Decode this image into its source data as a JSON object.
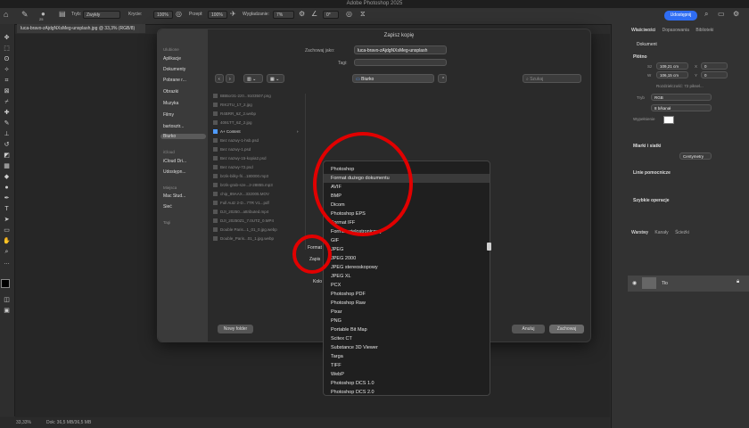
{
  "app": {
    "title": "Adobe Photoshop 2025",
    "share_label": "Udostępnij"
  },
  "options_bar": {
    "mode_label": "Tryb:",
    "mode_value": "Zwykły",
    "opacity_label": "Krycie:",
    "opacity_value": "100%",
    "flow_label": "Przepł:",
    "flow_value": "100%",
    "smoothing_label": "Wygładzanie:",
    "smoothing_value": "7%",
    "angle_value": "0°",
    "brush_size": "25"
  },
  "document_tab": {
    "label": "luca-bravo-zAjdgNXsMeg-unsplash.jpg @ 33,3% (RGB/8)"
  },
  "status": {
    "zoom": "33,33%",
    "doc": "Dok: 36,5 MB/36,5 MB"
  },
  "dialog": {
    "title": "Zapisz kopię",
    "save_as_label": "Zachowaj jako:",
    "save_as_value": "luca-bravo-zAjdgNXsMeg-unsplash",
    "tags_label": "Tagi:",
    "location": "Biurko",
    "search_placeholder": "Szukaj",
    "format_label": "Format",
    "save_label": "Zapis",
    "color_label": "Kolo",
    "new_folder": "Nowy folder",
    "cancel": "Anuluj",
    "save": "Zachowaj",
    "sidebar": {
      "favorites_items": [
        "Aplikacje",
        "Dokumenty",
        "Pobrane r...",
        "Obrazki",
        "Muzyka",
        "Filmy",
        "bartosztr...",
        "Biurko"
      ],
      "icloud_heading": "iCloud",
      "icloud_items": [
        "iCloud Dri...",
        "Udostępn..."
      ],
      "locations_heading": "Miejsca",
      "locations_items": [
        "Mac Stud...",
        "Sieć"
      ],
      "tags_heading": "Tagi"
    },
    "files": [
      "BBBor31-2z0...9103507.png",
      "RIK2TU_17_2.jpg",
      "R4BRR_6Z_2.webp",
      "4091TT_6Z_2.jpg",
      "A+ Content",
      "Bez nazwy-1-hsb.psd",
      "Bez nazwy-1.psd",
      "Bez nazwy-15-kopia2.psd",
      "Bez nazwy-72.psd",
      "brzik-bilky-fri...180000.mp3",
      "brzik-grab-sze...2-28855.mp3",
      "chip_89AAX...332005.MOV",
      "Full Autz 2-D...7TR V1...pdf",
      "DJI_20250...attributed.mp4",
      "DJI_20250Z1_7.0UTZ_0.MP4",
      "Double Paris...1_01_0.jpg.webp",
      "Double_Paris...01_1.jpg.webp"
    ]
  },
  "format_menu": {
    "items": [
      "Photoshop",
      "Format dużego dokumentu",
      "AVIF",
      "BMP",
      "Dicom",
      "Photoshop EPS",
      "Format IFF",
      "Format wielostronicowy",
      "GIF",
      "JPEG",
      "JPEG 2000",
      "JPEG stereoskopowy",
      "JPEG XL",
      "PCX",
      "Photoshop PDF",
      "Photoshop Raw",
      "Pixar",
      "PNG",
      "Portable Bit Map",
      "Scitex CT",
      "Substance 3D Viewer",
      "Targa",
      "TIFF",
      "WebP",
      "Photoshop DCS 1.0",
      "Photoshop DCS 2.0"
    ],
    "selected": "Format dużego dokumentu"
  },
  "right_panel": {
    "tabs": [
      "Właściwości",
      "Dopasowania",
      "Biblioteki"
    ],
    "doc_label": "Dokument",
    "canvas_section": "Płótno",
    "width_value": "109,21 cm",
    "height_value": "106,15 cm",
    "x_value": "0",
    "y_value": "0",
    "resolution": "Rozdzielczość: 72 piksel...",
    "mode_label": "Tryb",
    "mode_value": "RGB",
    "depth_value": "8 b/kanał",
    "fill_label": "Wypełnienie",
    "rulers_section": "Miarki i siatki",
    "units_value": "Centymetry",
    "guides_section": "Linie pomocnicze",
    "quick_actions": "Szybkie operacje",
    "layers_tabs": [
      "Warstwy",
      "Kanały",
      "Ścieżki"
    ],
    "layer_name": "Tło"
  },
  "colors": {
    "accent": "#2f6df3",
    "ring": "#e10000",
    "menu_bg": "#1f1f1f",
    "dialog_bg": "#2a2a2a",
    "sidebar_bg": "#3a3a3a"
  }
}
